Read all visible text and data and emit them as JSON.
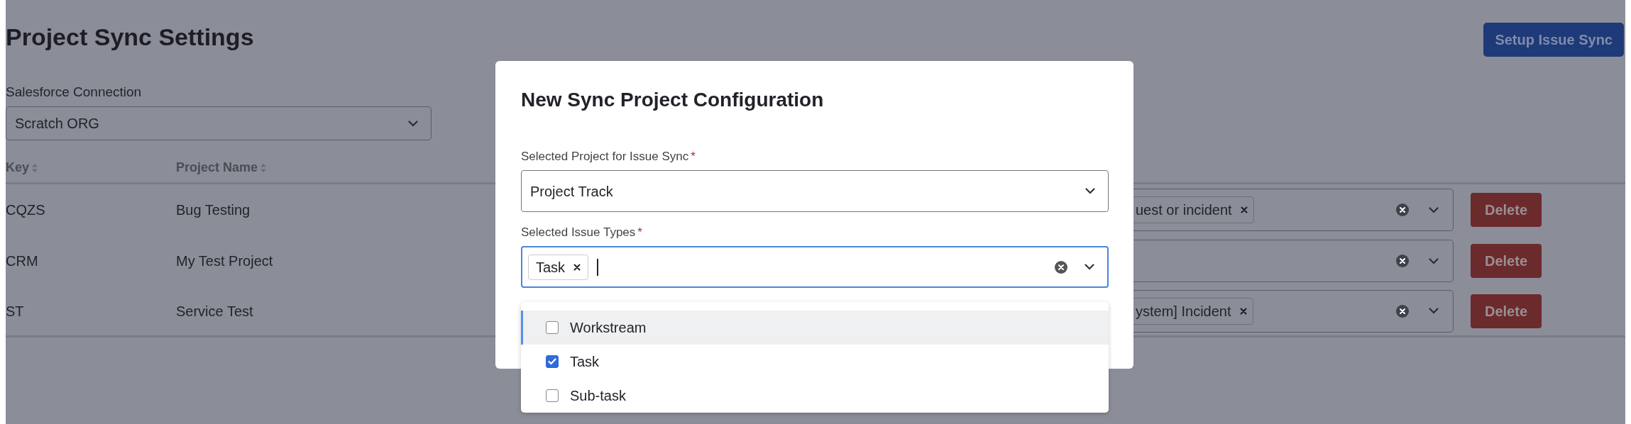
{
  "page": {
    "title": "Project Sync Settings",
    "setup_button": "Setup Issue Sync",
    "connection": {
      "label": "Salesforce Connection",
      "value": "Scratch ORG"
    }
  },
  "table": {
    "columns": [
      {
        "label": "Key",
        "sortable": true
      },
      {
        "label": "Project Name",
        "sortable": true
      }
    ],
    "rows": [
      {
        "key": "CQZS",
        "project_name": "Bug Testing",
        "issue_type_tag": "uest or incident",
        "action": "Delete"
      },
      {
        "key": "CRM",
        "project_name": "My Test Project",
        "action": "Delete"
      },
      {
        "key": "ST",
        "project_name": "Service Test",
        "issue_type_tag": "ystem] Incident",
        "action": "Delete"
      }
    ]
  },
  "modal": {
    "title": "New Sync Project Configuration",
    "fields": [
      {
        "kind": "select",
        "label": "Selected Project for Issue Sync",
        "required_mark": "*",
        "value": "Project Track"
      },
      {
        "kind": "multiselect",
        "label": "Selected Issue Types",
        "required_mark": "*",
        "tags": [
          "Task"
        ],
        "focused": true
      }
    ],
    "options": [
      {
        "label": "Workstream",
        "checked": false,
        "highlighted": true
      },
      {
        "label": "Task",
        "checked": true,
        "highlighted": false
      },
      {
        "label": "Sub-task",
        "checked": false,
        "highlighted": false
      }
    ]
  }
}
